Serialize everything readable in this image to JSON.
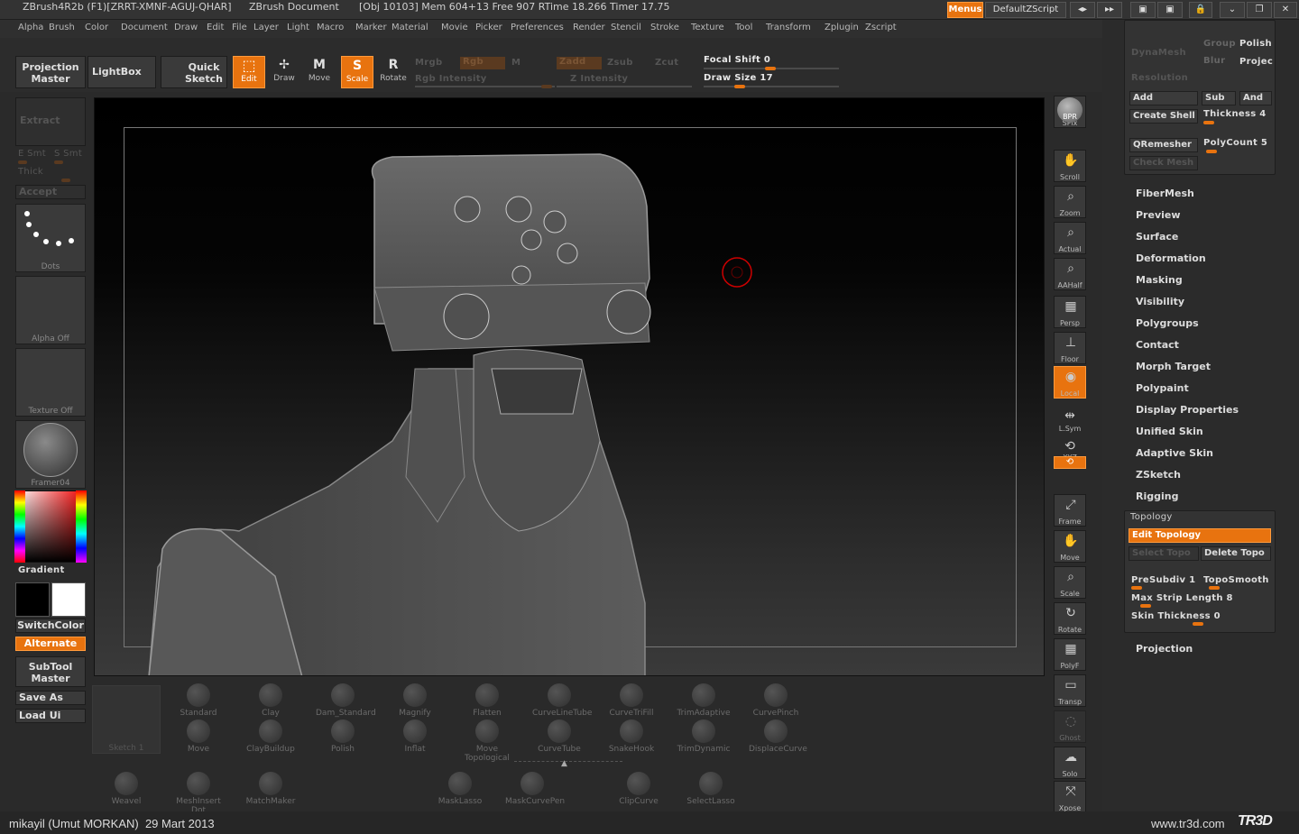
{
  "titlebar": {
    "app": "ZBrush4R2b (F1)[ZRRT-XMNF-AGUJ-QHAR]",
    "doc": "ZBrush Document",
    "stats": "[Obj 10103] Mem 604+13 Free 907 RTime 18.266 Timer 17.75",
    "menus_btn": "Menus",
    "script_btn": "DefaultZScript"
  },
  "menubar": [
    "Alpha",
    "Brush",
    "Color",
    "Document",
    "Draw",
    "Edit",
    "File",
    "Layer",
    "Light",
    "Macro",
    "Marker",
    "Material",
    "Movie",
    "Picker",
    "Preferences",
    "Render",
    "Stencil",
    "Stroke",
    "Texture",
    "Tool",
    "Transform",
    "Zplugin",
    "Zscript"
  ],
  "shelf": {
    "projection_master": "Projection Master",
    "lightbox": "LightBox",
    "quick_sketch": "Quick Sketch",
    "edit": "Edit",
    "draw": "Draw",
    "move": "Move",
    "scale": "Scale",
    "rotate": "Rotate",
    "mrgb": "Mrgb",
    "rgb": "Rgb",
    "m": "M",
    "rgb_intensity": "Rgb Intensity",
    "zadd": "Zadd",
    "zsub": "Zsub",
    "zcut": "Zcut",
    "z_intensity": "Z Intensity",
    "focal_shift": "Focal Shift 0",
    "draw_size": "Draw Size 17"
  },
  "left": {
    "extract": "Extract",
    "e_smt": "E Smt",
    "s_smt": "S Smt",
    "thick": "Thick",
    "accept": "Accept",
    "stroke_cap": "Dots",
    "alpha_cap": "Alpha Off",
    "texture_cap": "Texture Off",
    "material_cap": "Framer04",
    "gradient": "Gradient",
    "switchcolor": "SwitchColor",
    "alternate": "Alternate",
    "subtool_master": "SubTool Master",
    "save_as": "Save As",
    "load_ui": "Load Ui"
  },
  "right_tools": [
    {
      "name": "bpr",
      "label": "SPix"
    },
    {
      "name": "scroll",
      "label": "Scroll"
    },
    {
      "name": "zoom",
      "label": "Zoom"
    },
    {
      "name": "actual",
      "label": "Actual"
    },
    {
      "name": "aahalf",
      "label": "AAHalf"
    },
    {
      "name": "persp",
      "label": "Persp"
    },
    {
      "name": "floor",
      "label": "Floor"
    },
    {
      "name": "local",
      "label": "Local"
    },
    {
      "name": "lsym",
      "label": "L.Sym"
    },
    {
      "name": "xyz",
      "label": "XYZ"
    },
    {
      "name": "frame",
      "label": "Frame"
    },
    {
      "name": "move",
      "label": "Move"
    },
    {
      "name": "scale",
      "label": "Scale"
    },
    {
      "name": "rotate",
      "label": "Rotate"
    },
    {
      "name": "polyf",
      "label": "PolyF"
    },
    {
      "name": "transp",
      "label": "Transp"
    },
    {
      "name": "ghost",
      "label": "Ghost"
    },
    {
      "name": "solo",
      "label": "Solo"
    },
    {
      "name": "xpose",
      "label": "Xpose"
    }
  ],
  "bpr_label": "BPR",
  "palette": {
    "dynamesh": "DynaMesh",
    "group": "Group",
    "polish": "Polish",
    "blur": "Blur",
    "projec": "Projec",
    "resolution": "Resolution",
    "add": "Add",
    "sub": "Sub",
    "and": "And",
    "create_shell": "Create Shell",
    "thickness": "Thickness 4",
    "qremesher": "QRemesher",
    "polycount": "PolyCount 5",
    "check_mesh": "Check Mesh",
    "sections": [
      "FiberMesh",
      "Preview",
      "Surface",
      "Deformation",
      "Masking",
      "Visibility",
      "Polygroups",
      "Contact",
      "Morph Target",
      "Polypaint",
      "Display Properties",
      "Unified Skin",
      "Adaptive Skin",
      "ZSketch",
      "Rigging"
    ],
    "topology": "Topology",
    "edit_topology": "Edit Topology",
    "select_topo": "Select Topo",
    "delete_topo": "Delete Topo",
    "presubdiv": "PreSubdiv 1",
    "toposmooth": "TopoSmooth",
    "max_strip": "Max Strip Length 8",
    "skin_thickness": "Skin Thickness 0",
    "projection": "Projection"
  },
  "brushes_row1": [
    "Standard",
    "Clay",
    "Dam_Standard",
    "Magnify",
    "Flatten",
    "CurveLineTube",
    "CurveTriFill",
    "TrimAdaptive",
    "CurvePinch"
  ],
  "brushes_row2": [
    "Move",
    "ClayBuildup",
    "Polish",
    "Inflat",
    "Move Topological",
    "CurveTube",
    "SnakeHook",
    "TrimDynamic",
    "DisplaceCurve"
  ],
  "brushes_row3": [
    "Weavel",
    "MeshInsert Dot",
    "MatchMaker",
    "MaskLasso",
    "MaskCurvePen",
    "ClipCurve",
    "SelectLasso"
  ],
  "sketch_cap": "Sketch 1",
  "footer": {
    "credit": "mikayil (Umut MORKAN)  29 Mart 2013",
    "site": "www.tr3d.com",
    "logo": "TR3D"
  },
  "colors": {
    "accent": "#e8730f",
    "bg": "#2a2a2a"
  }
}
